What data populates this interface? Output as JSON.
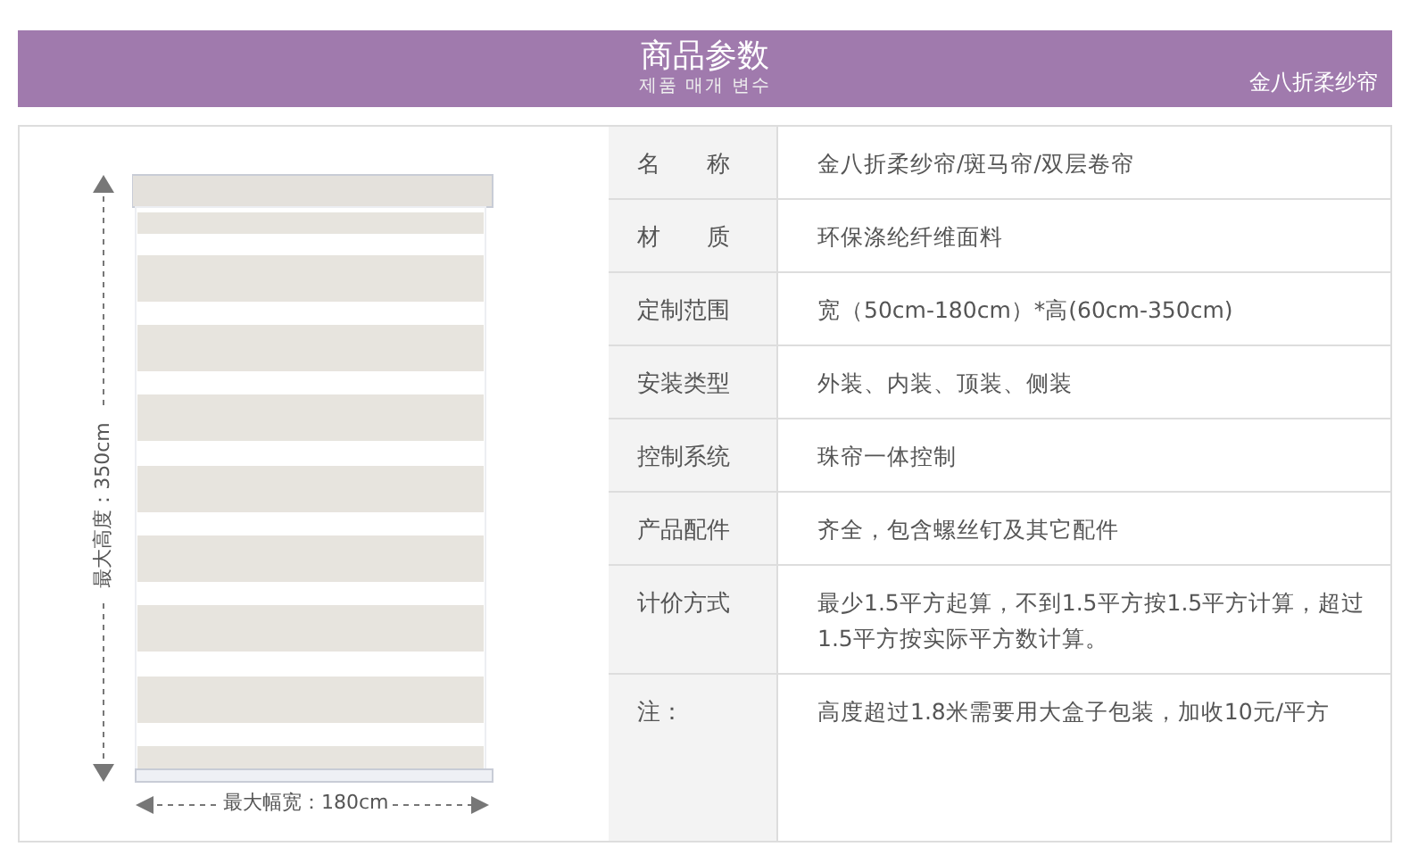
{
  "header": {
    "title": "商品参数",
    "subtitle": "제품 매개 변수",
    "product": "金八折柔纱帘"
  },
  "diagram": {
    "height_label": "最大高度：350cm",
    "width_label": "最大幅宽：180cm"
  },
  "specs": [
    {
      "label": "名　　称",
      "value": "金八折柔纱帘/斑马帘/双层卷帘"
    },
    {
      "label": "材　　质",
      "value": "环保涤纶纤维面料"
    },
    {
      "label": "定制范围",
      "value": "宽（50cm-180cm）*高(60cm-350cm)"
    },
    {
      "label": "安装类型",
      "value": "外装、内装、顶装、侧装"
    },
    {
      "label": "控制系统",
      "value": "珠帘一体控制"
    },
    {
      "label": "产品配件",
      "value": "齐全，包含螺丝钉及其它配件"
    },
    {
      "label": "计价方式",
      "value": "最少1.5平方起算，不到1.5平方按1.5平方计算，超过1.5平方按实际平方数计算。",
      "kind": "tall"
    },
    {
      "label": "注：",
      "value": "高度超过1.8米需要用大盒子包装，加收10元/平方",
      "kind": "note"
    }
  ]
}
